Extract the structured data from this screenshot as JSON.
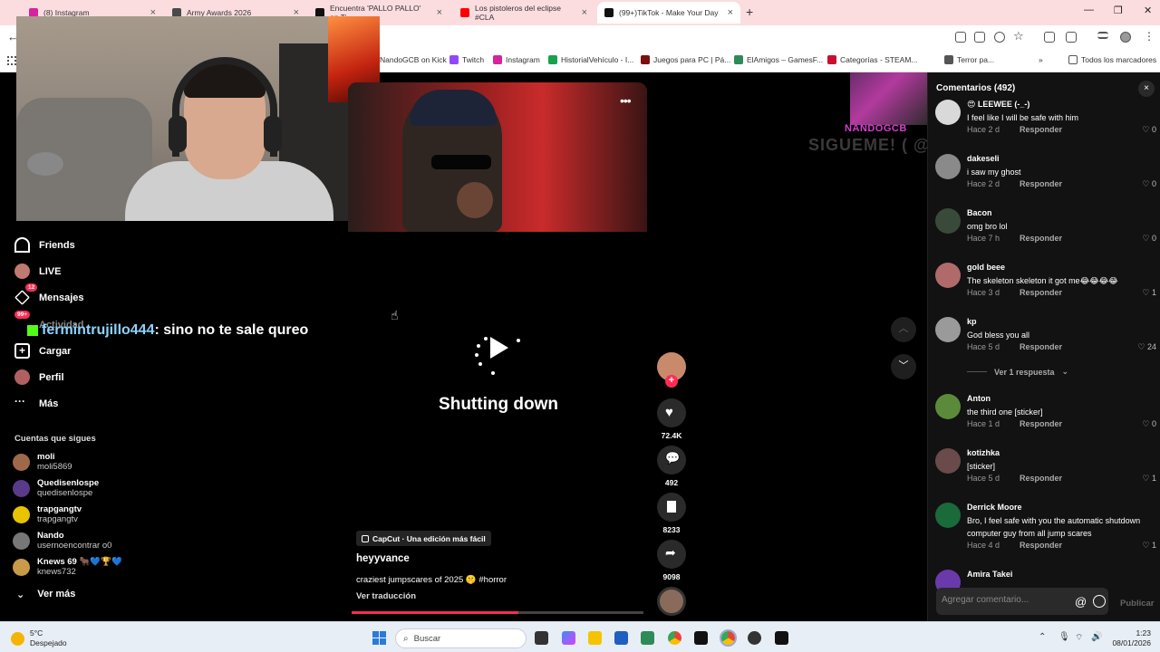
{
  "browser": {
    "tabs": [
      {
        "label": "(8) Instagram",
        "color": "#d6249f",
        "active": false
      },
      {
        "label": "Army Awards 2026",
        "color": "#4a4a4a",
        "active": false
      },
      {
        "label": "Encuentra 'PALLO PALLO' en Ti",
        "color": "#111111",
        "active": false
      },
      {
        "label": "Los pistoleros del eclipse #CLA",
        "color": "#ff0000",
        "active": false
      },
      {
        "label": "(99+)TikTok - Make Your Day",
        "color": "#111111",
        "active": true
      }
    ],
    "new_tab": "+",
    "bookmarks": [
      {
        "label": "NandoGCB on Kick",
        "color": "#53fc18"
      },
      {
        "label": "Twitch",
        "color": "#9146ff"
      },
      {
        "label": "Instagram",
        "color": "#d6249f"
      },
      {
        "label": "HistorialVehículo - I...",
        "color": "#16a34a"
      },
      {
        "label": "Juegos para PC | Pá...",
        "color": "#7a1010"
      },
      {
        "label": "ElAmigos – GamesF...",
        "color": "#2e8b57"
      },
      {
        "label": "Categorías - STEAM...",
        "color": "#c8102e"
      },
      {
        "label": "Terror pa...",
        "color": "#555555"
      }
    ],
    "all_bookmarks": "Todos los marcadores"
  },
  "sidebar": {
    "items": [
      {
        "label": "Friends",
        "icon": "friends-icon"
      },
      {
        "label": "LIVE",
        "icon": "live-icon"
      },
      {
        "label": "Mensajes",
        "icon": "messages-icon",
        "badge": "12"
      },
      {
        "label": "Actividad",
        "icon": "activity-icon",
        "badge": "99+"
      },
      {
        "label": "Cargar",
        "icon": "upload-icon"
      },
      {
        "label": "Perfil",
        "icon": "profile-icon"
      },
      {
        "label": "Más",
        "icon": "more-icon"
      }
    ],
    "following_title": "Cuentas que sigues",
    "following": [
      {
        "name": "moli",
        "user": "moli5869",
        "color": "#a0684a"
      },
      {
        "name": "Quedisenlospe",
        "user": "quedisenlospe",
        "color": "#5a3a8a"
      },
      {
        "name": "trapgangtv",
        "user": "trapgangtv",
        "color": "#e8c400"
      },
      {
        "name": "Nando",
        "user": "usernoencontrar o0",
        "color": "#777777"
      },
      {
        "name": "Knews 69 🐂💙🏆💙",
        "user": "knews732",
        "color": "#c89a4a"
      }
    ],
    "see_more": "Ver más"
  },
  "chat": {
    "user": "fermintrujillo444",
    "message": ": sino no te sale qureo"
  },
  "video": {
    "status": "Shutting down",
    "capcut": "CapCut · Una edición más fácil",
    "author": "heyyvance",
    "description": "craziest jumpscares of 2025 🤫 #horror",
    "translate": "Ver traducción",
    "progress": 0.57
  },
  "actions": {
    "likes": "72.4K",
    "comments": "492",
    "saves": "8233",
    "shares": "9098"
  },
  "overlay": {
    "name": "NANDOGCB",
    "follow": "SIGUEME! ( @ S)"
  },
  "comments_panel": {
    "title": "Comentarios (492)",
    "close": "×",
    "items": [
      {
        "user": "😍 LEEWEE (-_-)",
        "text": "I feel like I will be safe with him",
        "time": "Hace 2 d",
        "likes": "0",
        "color": "#d9d9d9"
      },
      {
        "user": "dakeseli",
        "text": "i saw my ghost",
        "time": "Hace 2 d",
        "likes": "0",
        "color": "#8a8a8a"
      },
      {
        "user": "Bacon",
        "text": "omg bro lol",
        "time": "Hace 7 h",
        "likes": "0",
        "color": "#3a4a3a"
      },
      {
        "user": "gold beee",
        "text": "The skeleton skeleton it got me😂😂😂😂",
        "time": "Hace 3 d",
        "likes": "1",
        "color": "#b06a6a"
      },
      {
        "user": "kp",
        "text": "God bless you all",
        "time": "Hace 5 d",
        "likes": "24",
        "color": "#9a9a9a"
      },
      {
        "user": "Anton",
        "text": "the third one [sticker]",
        "time": "Hace 1 d",
        "likes": "0",
        "color": "#5a8a3a"
      },
      {
        "user": "kotizhka",
        "text": "[sticker]",
        "time": "Hace 5 d",
        "likes": "1",
        "color": "#6a4a4a"
      },
      {
        "user": "Derrick Moore",
        "text": "Bro, I feel safe with you the automatic shutdown computer guy from all jump scares",
        "time": "Hace 4 d",
        "likes": "1",
        "color": "#1a6a3a"
      },
      {
        "user": "Amira Takei",
        "text": "",
        "time": "",
        "likes": "",
        "color": "#6a3aaa"
      }
    ],
    "reply_label": "Responder",
    "view_replies": "Ver 1 respuesta",
    "input_placeholder": "Agregar comentario...",
    "post": "Publicar"
  },
  "taskbar": {
    "temp": "5°C",
    "weather": "Despejado",
    "search": "Buscar",
    "time": "1:23",
    "date": "08/01/2026"
  }
}
